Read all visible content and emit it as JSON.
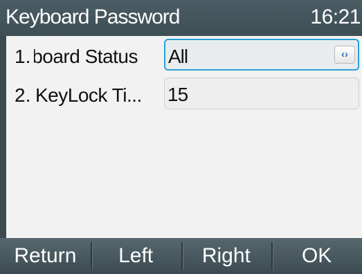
{
  "header": {
    "title": "Keyboard Password",
    "time": "16:21"
  },
  "rows": [
    {
      "index": "1.",
      "label": "Keyboard Status",
      "value": "All",
      "selected": true,
      "switch_icon": "‹›"
    },
    {
      "index": "2.",
      "label": "KeyLock Ti...",
      "value": "15",
      "selected": false
    }
  ],
  "softkeys": [
    "Return",
    "Left",
    "Right",
    "OK"
  ],
  "colors": {
    "header": "#3d4f55",
    "highlight": "#2aa0d8",
    "content_bg": "#f2f2f2"
  }
}
